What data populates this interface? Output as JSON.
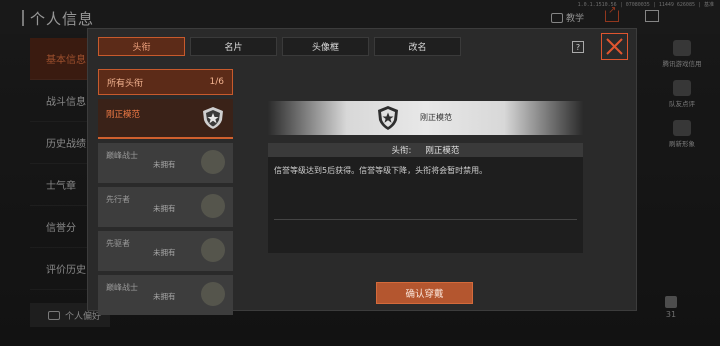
{
  "version_text": "1.0.1.1510.56 | 07080035 | 11449 626085 | 基准",
  "header": {
    "title": "个人信息",
    "teach_label": "教学"
  },
  "left_nav": {
    "items": [
      {
        "label": "基本信息"
      },
      {
        "label": "战斗信息"
      },
      {
        "label": "历史战绩"
      },
      {
        "label": "士气章"
      },
      {
        "label": "信誉分"
      },
      {
        "label": "评价历史"
      }
    ],
    "personal_label": "个人偏好"
  },
  "right_side": {
    "items": [
      {
        "label": "腾讯游戏信用"
      },
      {
        "label": "队友点评"
      },
      {
        "label": "刷新形象"
      }
    ],
    "likes": "31"
  },
  "modal": {
    "tabs": [
      {
        "label": "头衔"
      },
      {
        "label": "名片"
      },
      {
        "label": "头像框"
      },
      {
        "label": "改名"
      }
    ],
    "help_label": "?",
    "list_header": {
      "label": "所有头衔",
      "count": "1/6"
    },
    "titles": [
      {
        "name": "刚正模范",
        "status": ""
      },
      {
        "name": "巅峰战士",
        "status": "未拥有"
      },
      {
        "name": "先行者",
        "status": "未拥有"
      },
      {
        "name": "先驱者",
        "status": "未拥有"
      },
      {
        "name": "巅峰战士",
        "status": "未拥有"
      }
    ],
    "detail": {
      "badge_name": "刚正模范",
      "header_label": "头衔:",
      "header_value": "刚正模范",
      "description": "信誉等级达到5后获得。信誉等级下降，头衔将会暂时禁用。"
    },
    "confirm_label": "确认穿戴"
  },
  "colors": {
    "accent": "#e0552f",
    "active_bg": "#5c2b18"
  }
}
